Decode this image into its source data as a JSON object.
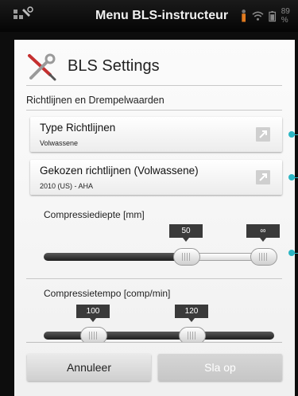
{
  "topbar": {
    "title": "Menu BLS-instructeur",
    "battery_pct": "89 %",
    "icons": [
      "tools-icon",
      "person-icon",
      "wifi-icon",
      "battery-icon"
    ]
  },
  "dialog": {
    "title": "BLS Settings",
    "section_label": "Richtlijnen en Drempelwaarden",
    "options": [
      {
        "title": "Type Richtlijnen",
        "value": "Volwassene"
      },
      {
        "title": "Gekozen richtlijnen (Volwassene)",
        "value": "2010 (US) - AHA"
      }
    ],
    "sliders": [
      {
        "label": "Compressiediepte [mm]",
        "min_badge": "50",
        "max_badge": "∞"
      },
      {
        "label": "Compressietempo [comp/min]",
        "min_badge": "100",
        "max_badge": "120"
      }
    ],
    "buttons": {
      "cancel": "Annuleer",
      "save": "Sla op"
    }
  },
  "colors": {
    "accent": "#2bb6c4",
    "badge": "#3a3a3a"
  }
}
